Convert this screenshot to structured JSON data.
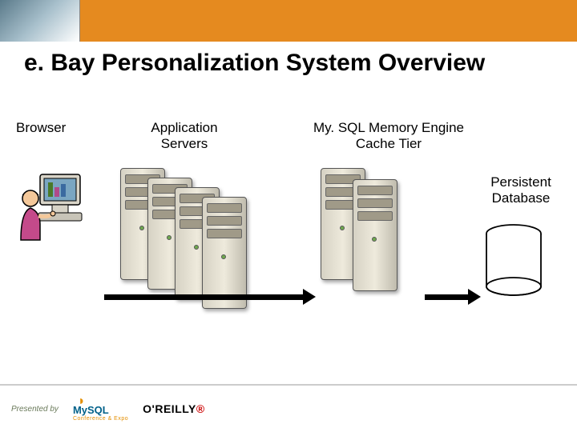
{
  "slide": {
    "title": "e. Bay Personalization System Overview"
  },
  "labels": {
    "browser": "Browser",
    "app_servers": "Application Servers",
    "cache_tier": "My. SQL Memory Engine Cache Tier",
    "persistent_db": "Persistent Database"
  },
  "diagram": {
    "components": [
      {
        "id": "browser",
        "type": "client",
        "count": 1
      },
      {
        "id": "app_servers",
        "type": "server-cluster",
        "count": 4
      },
      {
        "id": "cache_tier",
        "type": "server-cluster",
        "count": 2
      },
      {
        "id": "persistent_db",
        "type": "database",
        "count": 1
      }
    ],
    "flows": [
      {
        "from": "browser",
        "to": "cache_tier"
      },
      {
        "from": "cache_tier",
        "to": "persistent_db"
      }
    ]
  },
  "footer": {
    "presented_by": "Presented by",
    "sponsor1": "MySQL",
    "sponsor1_sub": "Conference & Expo",
    "sponsor2_pre": "O'REILLY",
    "sponsor2_mark": "®"
  },
  "icons": {
    "browser_user": "user-at-computer",
    "server": "tower-server",
    "database": "cylinder",
    "dolphin": "dolphin"
  },
  "colors": {
    "header": "#e58a1f",
    "arrow": "#000000",
    "server_body": "#eeeadc",
    "server_led": "#6fa84f"
  }
}
